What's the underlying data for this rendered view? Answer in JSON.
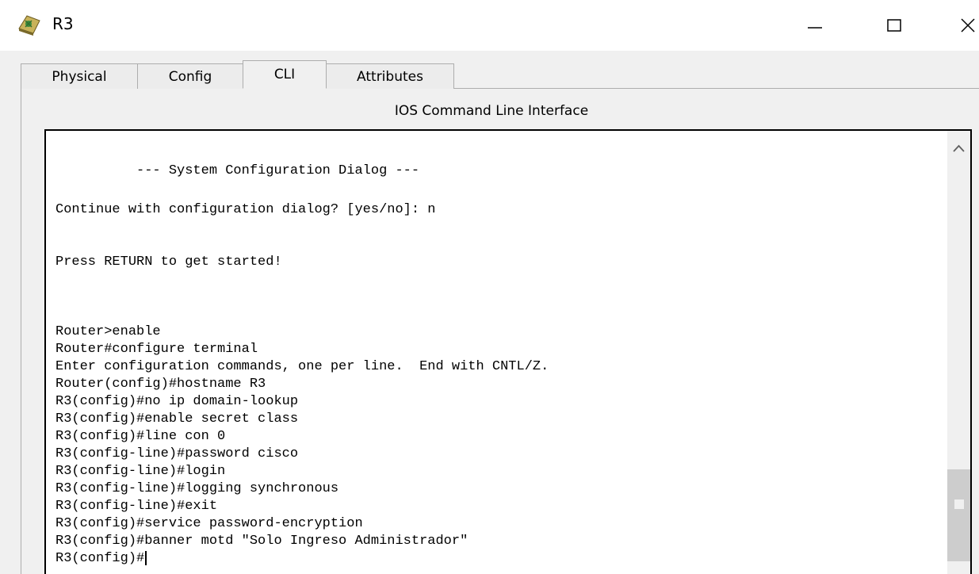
{
  "window": {
    "title": "R3",
    "icon": "router-app-icon",
    "controls": [
      "minimize-icon",
      "maximize-icon",
      "close-icon"
    ]
  },
  "tabs": [
    {
      "label": "Physical",
      "active": false
    },
    {
      "label": "Config",
      "active": false
    },
    {
      "label": "CLI",
      "active": true
    },
    {
      "label": "Attributes",
      "active": false
    }
  ],
  "panel": {
    "title": "IOS Command Line Interface"
  },
  "terminal": {
    "lines": [
      "          --- System Configuration Dialog ---",
      "Continue with configuration dialog? [yes/no]: n",
      "Press RETURN to get started!",
      "Router>enable",
      "Router#configure terminal",
      "Enter configuration commands, one per line.  End with CNTL/Z.",
      "Router(config)#hostname R3",
      "R3(config)#no ip domain-lookup",
      "R3(config)#enable secret class",
      "R3(config)#line con 0",
      "R3(config-line)#password cisco",
      "R3(config-line)#login",
      "R3(config-line)#logging synchronous",
      "R3(config-line)#exit",
      "R3(config)#service password-encryption",
      "R3(config)#banner motd \"Solo Ingreso Administrador\"",
      "R3(config)#"
    ]
  }
}
